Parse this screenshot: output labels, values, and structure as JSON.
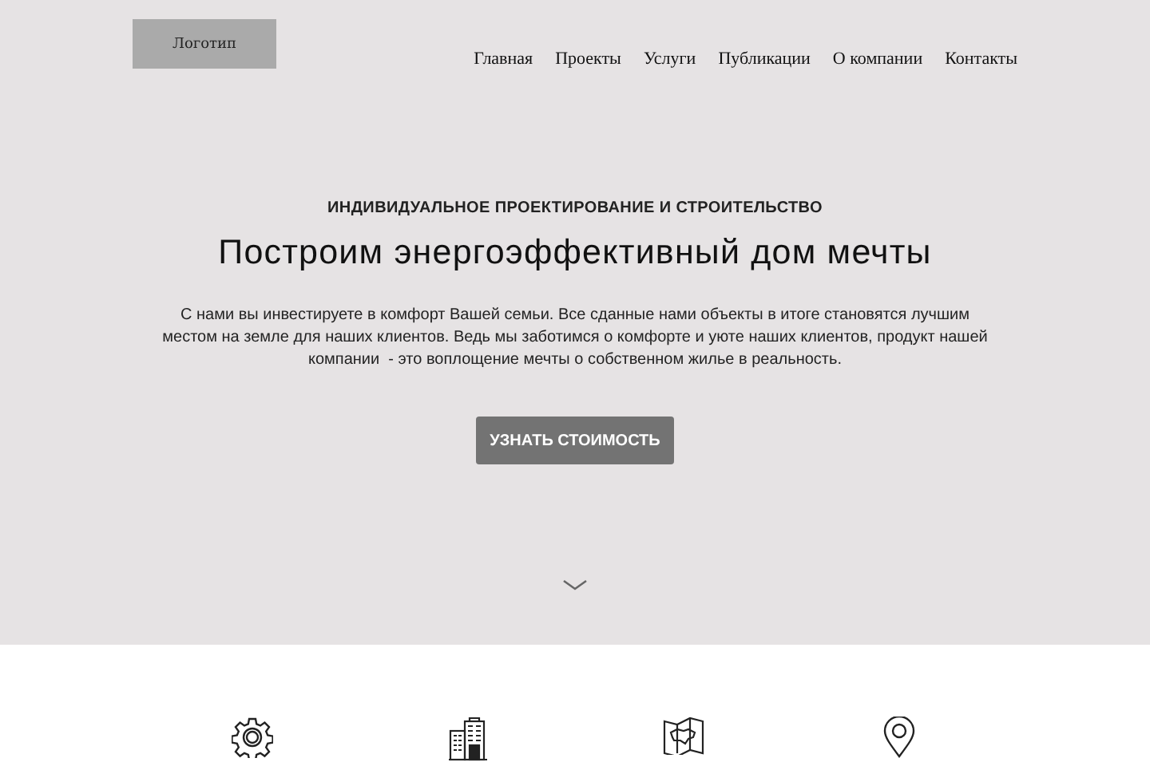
{
  "logo": "Логотип",
  "nav": [
    "Главная",
    "Проекты",
    "Услуги",
    "Публикации",
    "О компании",
    "Контакты"
  ],
  "hero": {
    "eyebrow": "ИНДИВИДУАЛЬНОЕ ПРОЕКТИРОВАНИЕ И СТРОИТЕЛЬСТВО",
    "title": "Построим энергоэффективный дом мечты",
    "text": "С нами вы инвестируете в комфорт Вашей семьи. Все сданные нами объекты в итоге становятся лучшим местом на земле для наших клиентов. Ведь мы заботимся о комфорте и уюте наших клиентов, продукт нашей компании  - это воплощение мечты о собственном жилье в реальность.",
    "button": "УЗНАТЬ СТОИМОСТЬ"
  },
  "features": [
    {
      "kind": "gear"
    },
    {
      "kind": "buildings"
    },
    {
      "kind": "map"
    },
    {
      "kind": "pin"
    }
  ]
}
